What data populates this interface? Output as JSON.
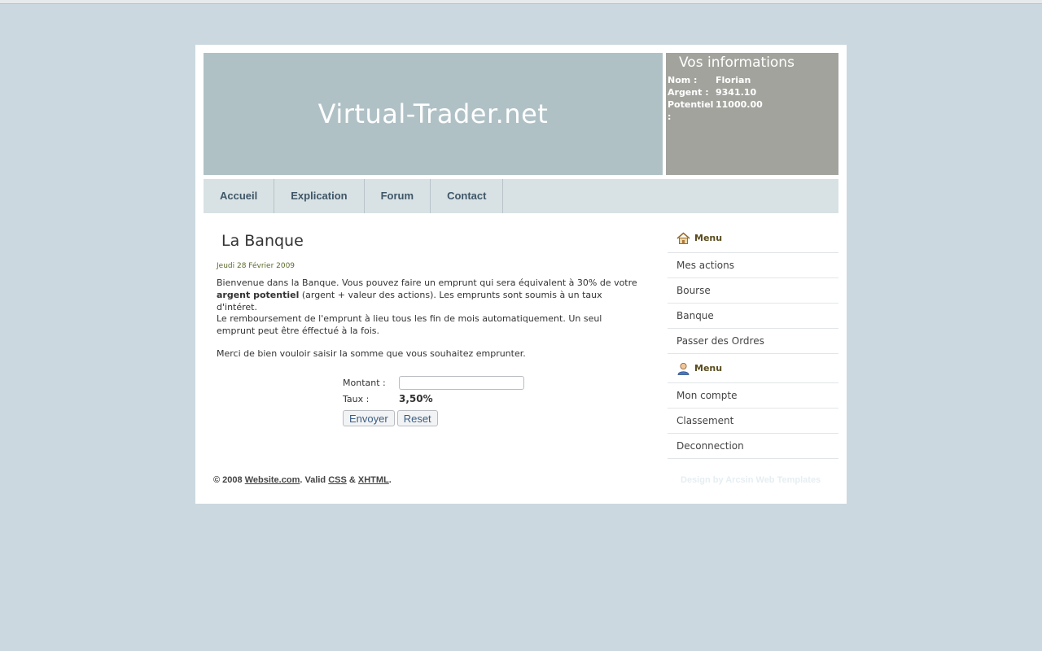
{
  "header": {
    "site_title": "Virtual-Trader.net",
    "info_title": "Vos informations",
    "info": [
      {
        "label": "Nom :",
        "value": "Florian"
      },
      {
        "label": "Argent :",
        "value": "9341.10"
      },
      {
        "label": "Potentiel :",
        "value": "11000.00"
      }
    ]
  },
  "nav": {
    "items": [
      "Accueil",
      "Explication",
      "Forum",
      "Contact"
    ]
  },
  "main": {
    "title": "La Banque",
    "date": "Jeudi 28 Février 2009",
    "p1_a": "Bienvenue dans la Banque. Vous pouvez faire un emprunt qui sera équivalent à 30% de votre ",
    "p1_bold": "argent potentiel",
    "p1_b": " (argent + valeur des actions). Les emprunts sont soumis à un taux d'intéret.",
    "p2": "Le remboursement de l'emprunt à lieu tous les fin de mois automatiquement. Un seul emprunt peut être éffectué à la fois.",
    "p3": "Merci de bien vouloir saisir la somme que vous souhaitez emprunter."
  },
  "form": {
    "amount_label": "Montant :",
    "amount_value": "",
    "rate_label": "Taux :",
    "rate_value": "3,50%",
    "submit_label": "Envoyer",
    "reset_label": "Reset"
  },
  "sidebar": {
    "menu1_title": "Menu",
    "menu1_icon": "home-icon",
    "menu1": [
      "Mes actions",
      "Bourse",
      "Banque",
      "Passer des Ordres"
    ],
    "menu2_title": "Menu",
    "menu2_icon": "user-icon",
    "menu2": [
      "Mon compte",
      "Classement",
      "Deconnection"
    ]
  },
  "footer": {
    "copyright": "© 2008 ",
    "site_link": "Website.com",
    "valid": ". Valid ",
    "css": "CSS",
    "amp": " & ",
    "xhtml": "XHTML",
    "end": ".",
    "design": "Design by Arcsin Web Templates"
  }
}
